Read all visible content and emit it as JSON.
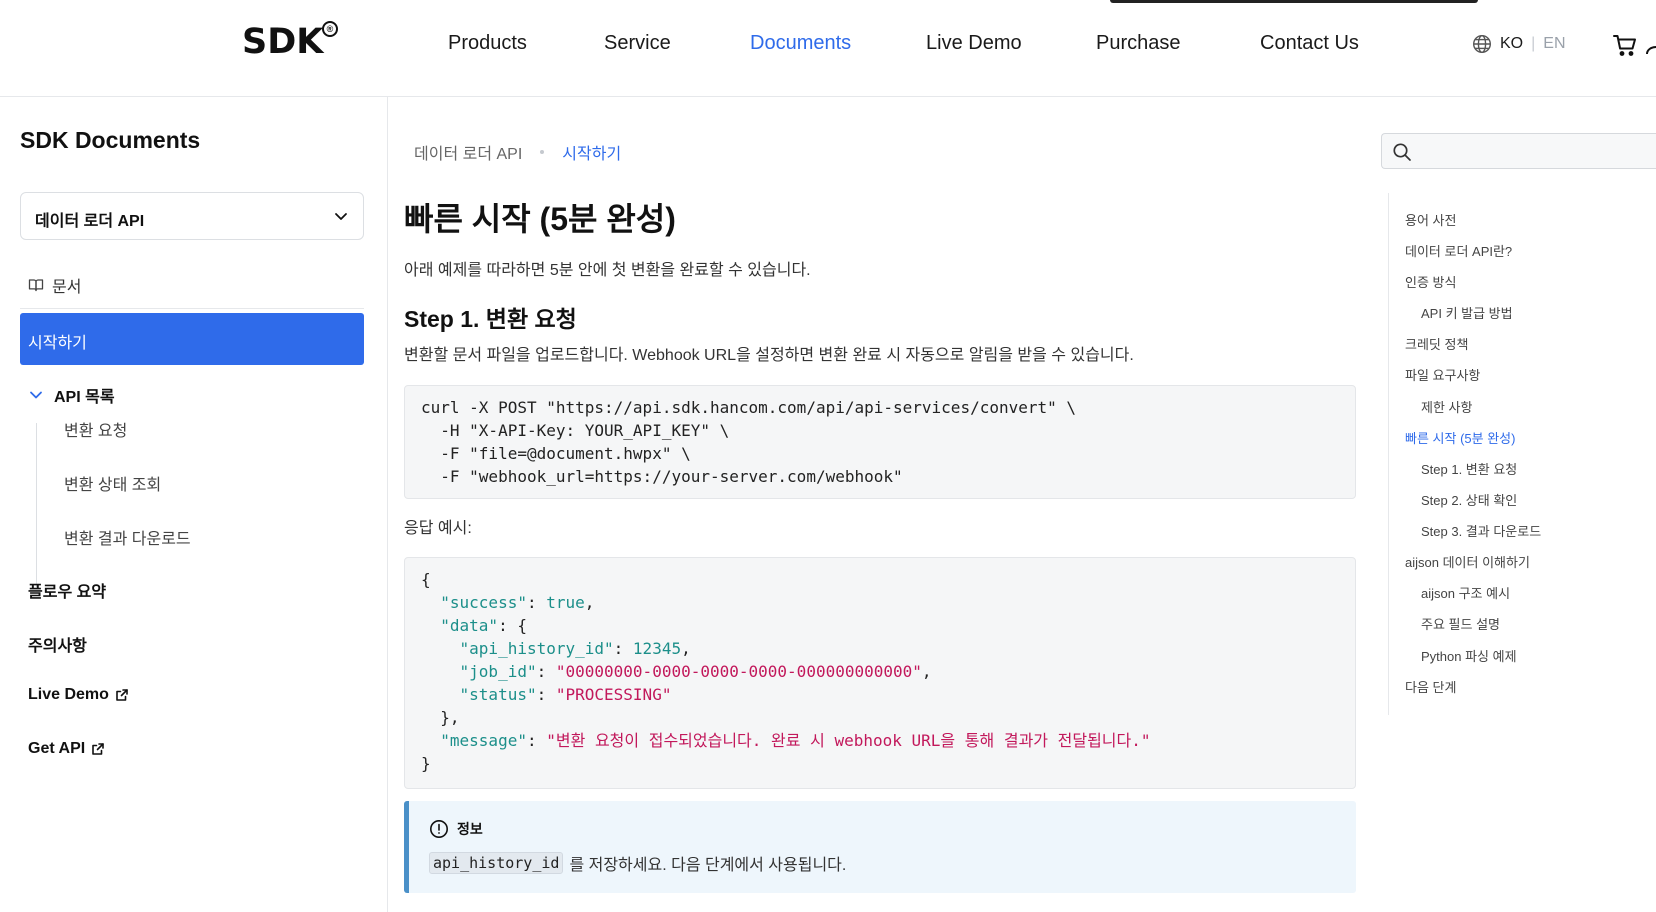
{
  "header": {
    "logo": "SDK",
    "logo_mark": "®",
    "nav": [
      "Products",
      "Service",
      "Documents",
      "Live Demo",
      "Purchase",
      "Contact Us"
    ],
    "active_nav": "Documents",
    "lang_ko": "KO",
    "lang_sep": "|",
    "lang_en": "EN",
    "icons": [
      "globe-icon",
      "cart-icon"
    ]
  },
  "sidebar": {
    "title": "SDK Documents",
    "select_value": "데이터 로더 API",
    "docs_label": "문서",
    "active_item": "시작하기",
    "group_label": "API 목록",
    "sub_items": [
      "변환 요청",
      "변환 상태 조회",
      "변환 결과 다운로드"
    ],
    "links": [
      "플로우 요약",
      "주의사항",
      "Live Demo",
      "Get API"
    ]
  },
  "breadcrumb": {
    "parent": "데이터 로더 API",
    "current": "시작하기"
  },
  "main": {
    "title": "빠른 시작 (5분 완성)",
    "intro": "아래 예제를 따라하면 5분 안에 첫 변환을 완료할 수 있습니다.",
    "step1_title": "Step 1. 변환 요청",
    "step1_desc": "변환할 문서 파일을 업로드합니다. Webhook URL을 설정하면 변환 완료 시 자동으로 알림을 받을 수 있습니다.",
    "code1_lines": [
      "curl -X POST \"https://api.sdk.hancom.com/api/api-services/convert\" \\",
      "  -H \"X-API-Key: YOUR_API_KEY\" \\",
      "  -F \"file=@document.hwpx\" \\",
      "  -F \"webhook_url=https://your-server.com/webhook\""
    ],
    "response_label": "응답 예시:",
    "json": {
      "success_key": "\"success\"",
      "success_val": "true",
      "data_key": "\"data\"",
      "history_key": "\"api_history_id\"",
      "history_val": "12345",
      "job_key": "\"job_id\"",
      "job_val": "\"00000000-0000-0000-0000-000000000000\"",
      "status_key": "\"status\"",
      "status_val": "\"PROCESSING\"",
      "message_key": "\"message\"",
      "message_val": "\"변환 요청이 접수되었습니다. 완료 시 webhook URL을 통해 결과가 전달됩니다.\""
    },
    "info_title": "정보",
    "info_code": "api_history_id",
    "info_text": "를 저장하세요. 다음 단계에서 사용됩니다."
  },
  "toc": {
    "search_placeholder": "",
    "items": [
      {
        "label": "용어 사전",
        "level": 1
      },
      {
        "label": "데이터 로더 API란?",
        "level": 1
      },
      {
        "label": "인증 방식",
        "level": 1
      },
      {
        "label": "API 키 발급 방법",
        "level": 2
      },
      {
        "label": "크레딧 정책",
        "level": 1
      },
      {
        "label": "파일 요구사항",
        "level": 1
      },
      {
        "label": "제한 사항",
        "level": 2
      },
      {
        "label": "빠른 시작 (5분 완성)",
        "level": 1,
        "active": true
      },
      {
        "label": "Step 1. 변환 요청",
        "level": 2
      },
      {
        "label": "Step 2. 상태 확인",
        "level": 2
      },
      {
        "label": "Step 3. 결과 다운로드",
        "level": 2
      },
      {
        "label": "aijson 데이터 이해하기",
        "level": 1
      },
      {
        "label": "aijson 구조 예시",
        "level": 2
      },
      {
        "label": "주요 필드 설명",
        "level": 2
      },
      {
        "label": "Python 파싱 예제",
        "level": 2
      },
      {
        "label": "다음 단계",
        "level": 1
      }
    ]
  },
  "colors": {
    "accent": "#2f6bea",
    "json_key": "#1c8f8a",
    "json_string": "#c2185b",
    "info_border": "#4a90c8"
  }
}
